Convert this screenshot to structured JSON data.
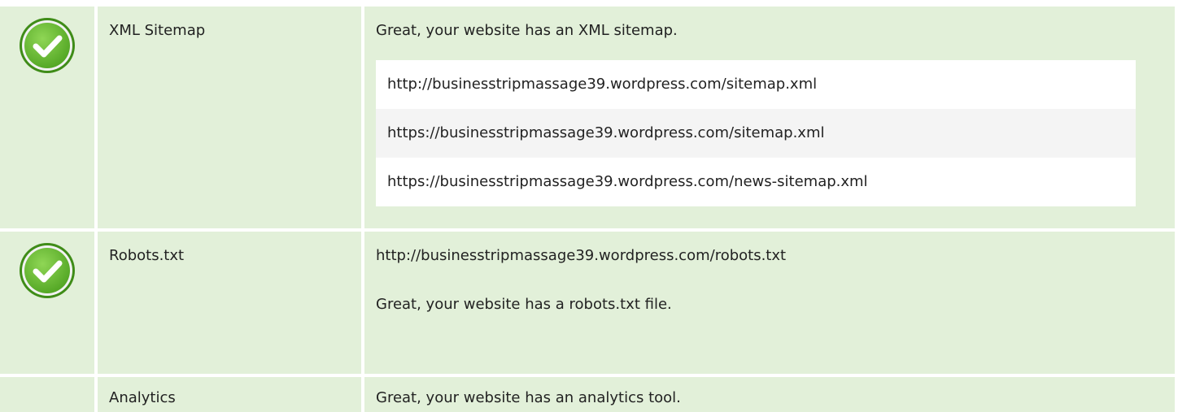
{
  "colors": {
    "row_bg": "#e2f0d9",
    "check_green": "#6fbf3a",
    "check_green_dark": "#4a9a1e"
  },
  "rows": [
    {
      "label": "XML Sitemap",
      "icon": "check-circle-icon",
      "message": "Great, your website has an XML sitemap.",
      "urls": [
        "http://businesstripmassage39.wordpress.com/sitemap.xml",
        "https://businesstripmassage39.wordpress.com/sitemap.xml",
        "https://businesstripmassage39.wordpress.com/news-sitemap.xml"
      ]
    },
    {
      "label": "Robots.txt",
      "icon": "check-circle-icon",
      "url": "http://businesstripmassage39.wordpress.com/robots.txt",
      "message": "Great, your website has a robots.txt file."
    },
    {
      "label": "Analytics",
      "message": "Great, your website has an analytics tool."
    }
  ]
}
